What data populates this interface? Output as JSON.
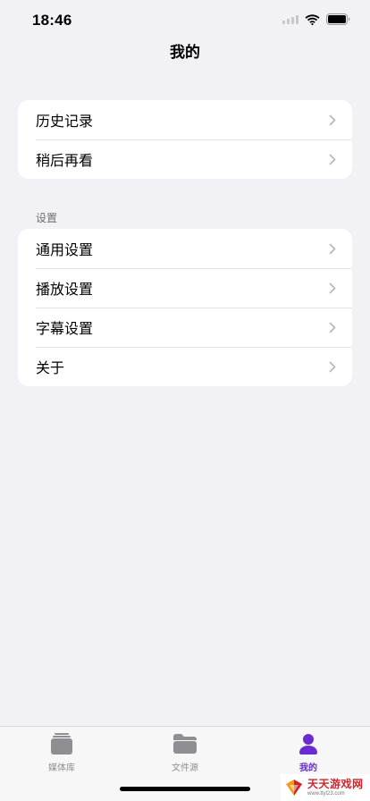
{
  "status_bar": {
    "time": "18:46"
  },
  "nav": {
    "title": "我的"
  },
  "group1": {
    "items": [
      {
        "label": "历史记录"
      },
      {
        "label": "稍后再看"
      }
    ]
  },
  "settings": {
    "header": "设置",
    "items": [
      {
        "label": "通用设置"
      },
      {
        "label": "播放设置"
      },
      {
        "label": "字幕设置"
      },
      {
        "label": "关于"
      }
    ]
  },
  "tab_bar": {
    "tabs": [
      {
        "label": "媒体库",
        "icon": "stack-icon"
      },
      {
        "label": "文件源",
        "icon": "folder-icon"
      },
      {
        "label": "我的",
        "icon": "person-icon",
        "active": true
      }
    ],
    "accent_color": "#6a2bd0"
  },
  "watermark": {
    "text": "天天游戏网",
    "url_text": "www.ttyl23.com"
  }
}
